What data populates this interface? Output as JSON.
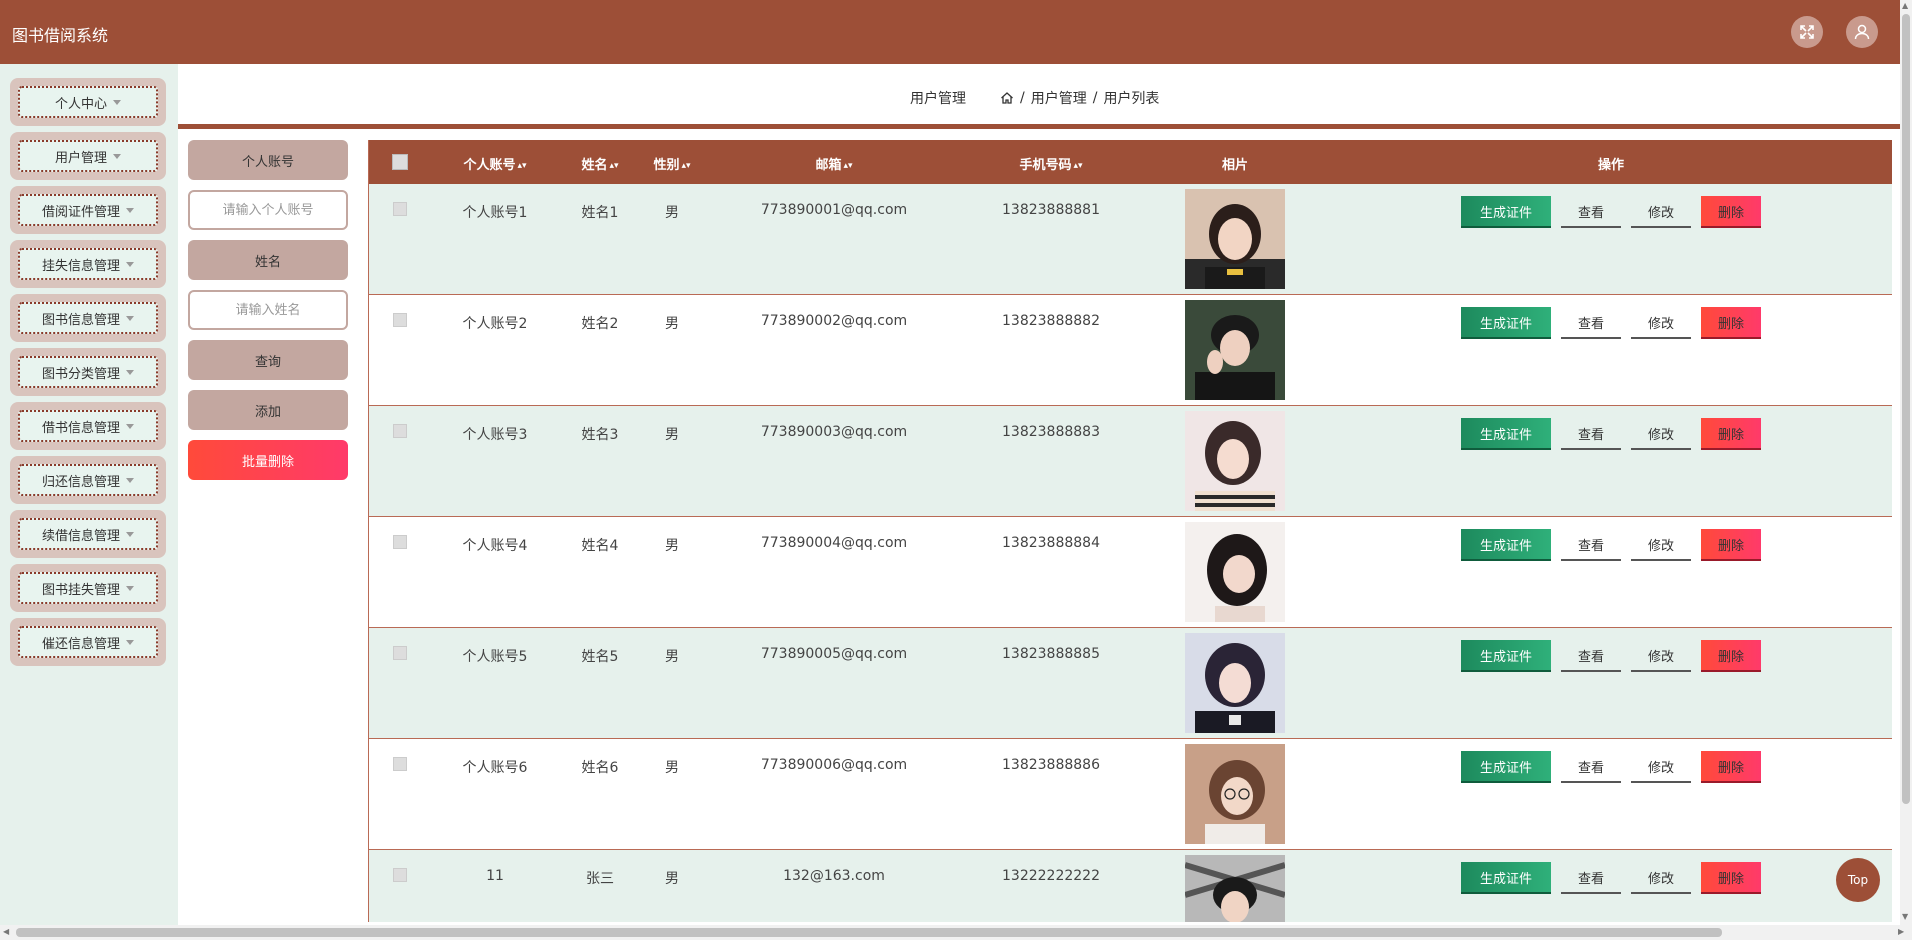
{
  "header": {
    "title": "图书借阅系统"
  },
  "sidebar": {
    "items": [
      {
        "label": "个人中心"
      },
      {
        "label": "用户管理"
      },
      {
        "label": "借阅证件管理"
      },
      {
        "label": "挂失信息管理"
      },
      {
        "label": "图书信息管理"
      },
      {
        "label": "图书分类管理"
      },
      {
        "label": "借书信息管理"
      },
      {
        "label": "归还信息管理"
      },
      {
        "label": "续借信息管理"
      },
      {
        "label": "图书挂失管理"
      },
      {
        "label": "催还信息管理"
      }
    ]
  },
  "breadcrumb": {
    "title": "用户管理",
    "path": [
      "用户管理",
      "用户列表"
    ],
    "separator": "/"
  },
  "search": {
    "account_label": "个人账号",
    "account_placeholder": "请输入个人账号",
    "name_label": "姓名",
    "name_placeholder": "请输入姓名",
    "query_label": "查询",
    "add_label": "添加",
    "batch_delete_label": "批量删除"
  },
  "table": {
    "columns": {
      "account": "个人账号",
      "name": "姓名",
      "gender": "性别",
      "email": "邮箱",
      "phone": "手机号码",
      "photo": "相片",
      "actions": "操作"
    },
    "actions": {
      "cert": "生成证件",
      "view": "查看",
      "edit": "修改",
      "delete": "删除"
    },
    "rows": [
      {
        "account": "个人账号1",
        "name": "姓名1",
        "gender": "男",
        "email": "773890001@qq.com",
        "phone": "13823888881"
      },
      {
        "account": "个人账号2",
        "name": "姓名2",
        "gender": "男",
        "email": "773890002@qq.com",
        "phone": "13823888882"
      },
      {
        "account": "个人账号3",
        "name": "姓名3",
        "gender": "男",
        "email": "773890003@qq.com",
        "phone": "13823888883"
      },
      {
        "account": "个人账号4",
        "name": "姓名4",
        "gender": "男",
        "email": "773890004@qq.com",
        "phone": "13823888884"
      },
      {
        "account": "个人账号5",
        "name": "姓名5",
        "gender": "男",
        "email": "773890005@qq.com",
        "phone": "13823888885"
      },
      {
        "account": "个人账号6",
        "name": "姓名6",
        "gender": "男",
        "email": "773890006@qq.com",
        "phone": "13823888886"
      },
      {
        "account": "11",
        "name": "张三",
        "gender": "男",
        "email": "132@163.com",
        "phone": "13222222222"
      }
    ]
  },
  "top_button": {
    "label": "Top"
  },
  "colors": {
    "primary": "#9d4f37",
    "row_tint": "#e6f1ec",
    "cert_button": "#1d8a5d",
    "delete_button": "#ff4a4a"
  }
}
